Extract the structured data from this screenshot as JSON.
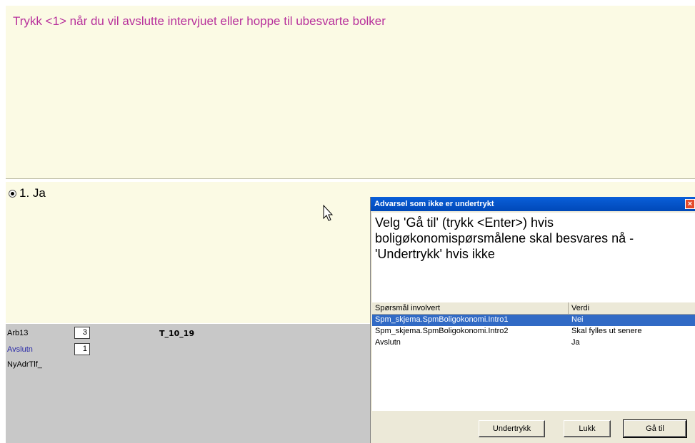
{
  "question": {
    "text": "Trykk <1> når du vil avslutte intervjuet eller hoppe til ubesvarte bolker"
  },
  "answer": {
    "option_label": "1. Ja",
    "selected": true
  },
  "fields": [
    {
      "label": "Arb13",
      "value": "3",
      "code": "T_10_19",
      "label_color": "#000000"
    },
    {
      "label": "Avslutn",
      "value": "1",
      "label_color": "#2a2aa8"
    },
    {
      "label": "NyAdrTlf_"
    }
  ],
  "dialog": {
    "title": "Advarsel som ikke er undertrykt",
    "close_label": "×",
    "message_lines": [
      "Velg 'Gå til' (trykk <Enter>) hvis",
      "boligøkonomispørsmålene skal besvares nå -",
      "'Undertrykk' hvis ikke"
    ],
    "columns": [
      "Spørsmål involvert",
      "Verdi"
    ],
    "rows": [
      {
        "question": "Spm_skjema.SpmBoligokonomi.Intro1",
        "value": "Nei",
        "selected": true
      },
      {
        "question": "Spm_skjema.SpmBoligokonomi.Intro2",
        "value": "Skal fylles ut senere",
        "selected": false
      },
      {
        "question": "Avslutn",
        "value": "Ja",
        "selected": false
      }
    ],
    "buttons": {
      "undertrykk": "Undertrykk",
      "lukk": "Lukk",
      "gatil": "Gå til"
    }
  },
  "colors": {
    "question_text": "#b8329c",
    "panel_bg": "#fbfae4",
    "fields_bg": "#c8c8c8",
    "selection": "#316ac5"
  }
}
